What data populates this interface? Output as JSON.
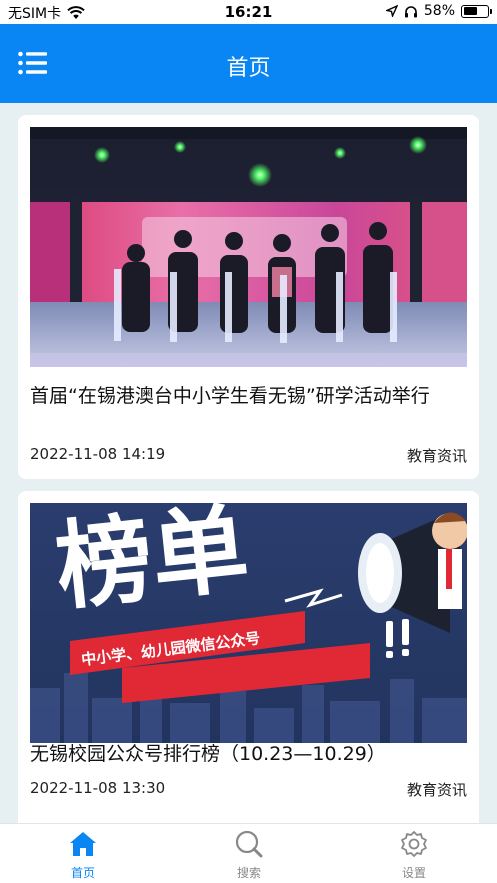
{
  "status_bar": {
    "carrier": "无SIM卡",
    "time": "16:21",
    "battery": "58%",
    "battery_level": 0.58
  },
  "header": {
    "title": "首页",
    "menu_icon": "list-menu-icon"
  },
  "articles": [
    {
      "title": "首届“在锡港澳台中小学生看无锡”研学活动举行",
      "date": "2022-11-08 14:19",
      "category": "教育资讯"
    },
    {
      "title": "无锡校园公众号排行榜（10.23—10.29）",
      "date": "2022-11-08 13:30",
      "category": "教育资讯",
      "banner": {
        "headline": "榜单",
        "subline": "中小学、幼儿园微信公众号"
      }
    }
  ],
  "tabbar": {
    "items": [
      {
        "label": "首页",
        "icon": "home-icon",
        "active": true
      },
      {
        "label": "搜索",
        "icon": "search-icon",
        "active": false
      },
      {
        "label": "设置",
        "icon": "gear-icon",
        "active": false
      }
    ]
  },
  "colors": {
    "primary": "#0a86f4",
    "background": "#e6eff2",
    "inactive_tab": "#888888"
  }
}
